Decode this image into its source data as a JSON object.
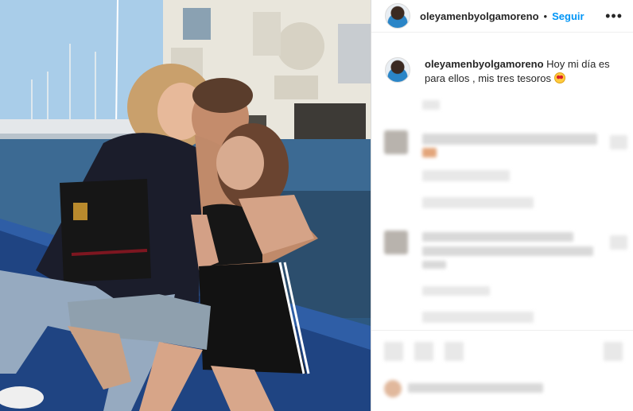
{
  "post": {
    "username": "oleyamenbyolgamoreno",
    "separator": "•",
    "follow_label": "Seguir",
    "more_label": "•••",
    "caption": "Hoy mi día es para ellos , mis tres tesoros"
  },
  "icons": {
    "avatar": "profile-avatar",
    "emoji": "heart-eyes-emoji",
    "more": "more-options-icon"
  },
  "colors": {
    "follow": "#0095f6",
    "text": "#262626",
    "divider": "#efefef"
  }
}
